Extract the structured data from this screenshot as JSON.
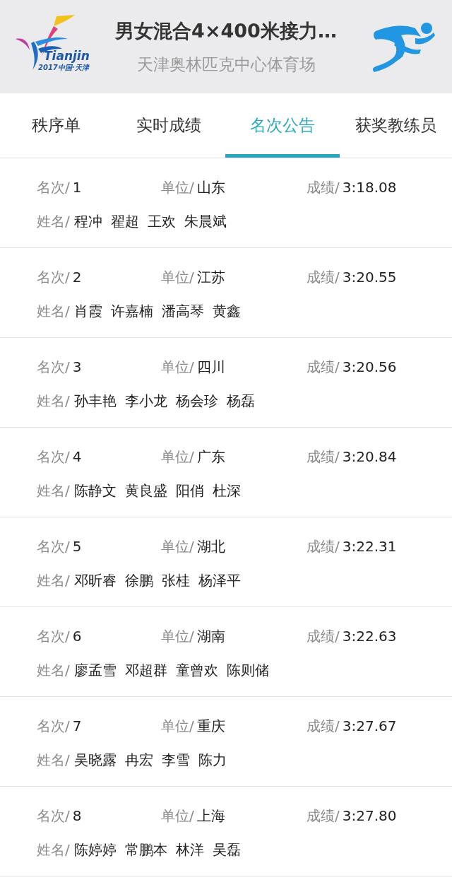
{
  "header": {
    "logo": {
      "wordmark": "Tianjin",
      "caption": "2017中国·天津"
    },
    "title": "男女混合4×400米接力…",
    "subtitle": "天津奥林匹克中心体育场"
  },
  "tabs": [
    {
      "label": "秩序单",
      "selected": false
    },
    {
      "label": "实时成绩",
      "selected": false
    },
    {
      "label": "名次公告",
      "selected": true
    },
    {
      "label": "获奖教练员",
      "selected": false
    }
  ],
  "results": [
    {
      "rank_label": "名次/",
      "rank": "1",
      "unit_label": "单位/",
      "unit": "山东",
      "time_label": "成绩/",
      "time": "3:18.08",
      "names_label": "姓名/",
      "names": [
        "程冲",
        "翟超",
        "王欢",
        "朱晨斌"
      ]
    },
    {
      "rank_label": "名次/",
      "rank": "2",
      "unit_label": "单位/",
      "unit": "江苏",
      "time_label": "成绩/",
      "time": "3:20.55",
      "names_label": "姓名/",
      "names": [
        "肖霞",
        "许嘉楠",
        "潘高琴",
        "黄鑫"
      ]
    },
    {
      "rank_label": "名次/",
      "rank": "3",
      "unit_label": "单位/",
      "unit": "四川",
      "time_label": "成绩/",
      "time": "3:20.56",
      "names_label": "姓名/",
      "names": [
        "孙丰艳",
        "李小龙",
        "杨会珍",
        "杨磊"
      ]
    },
    {
      "rank_label": "名次/",
      "rank": "4",
      "unit_label": "单位/",
      "unit": "广东",
      "time_label": "成绩/",
      "time": "3:20.84",
      "names_label": "姓名/",
      "names": [
        "陈静文",
        "黄良盛",
        "阳俏",
        "杜深"
      ]
    },
    {
      "rank_label": "名次/",
      "rank": "5",
      "unit_label": "单位/",
      "unit": "湖北",
      "time_label": "成绩/",
      "time": "3:22.31",
      "names_label": "姓名/",
      "names": [
        "邓昕睿",
        "徐鹏",
        "张桂",
        "杨泽平"
      ]
    },
    {
      "rank_label": "名次/",
      "rank": "6",
      "unit_label": "单位/",
      "unit": "湖南",
      "time_label": "成绩/",
      "time": "3:22.63",
      "names_label": "姓名/",
      "names": [
        "廖孟雪",
        "邓超群",
        "童曾欢",
        "陈则储"
      ]
    },
    {
      "rank_label": "名次/",
      "rank": "7",
      "unit_label": "单位/",
      "unit": "重庆",
      "time_label": "成绩/",
      "time": "3:27.67",
      "names_label": "姓名/",
      "names": [
        "吴晓露",
        "冉宏",
        "李雪",
        "陈力"
      ]
    },
    {
      "rank_label": "名次/",
      "rank": "8",
      "unit_label": "单位/",
      "unit": "上海",
      "time_label": "成绩/",
      "time": "3:27.80",
      "names_label": "姓名/",
      "names": [
        "陈婷婷",
        "常鹏本",
        "林洋",
        "吴磊"
      ]
    }
  ]
}
